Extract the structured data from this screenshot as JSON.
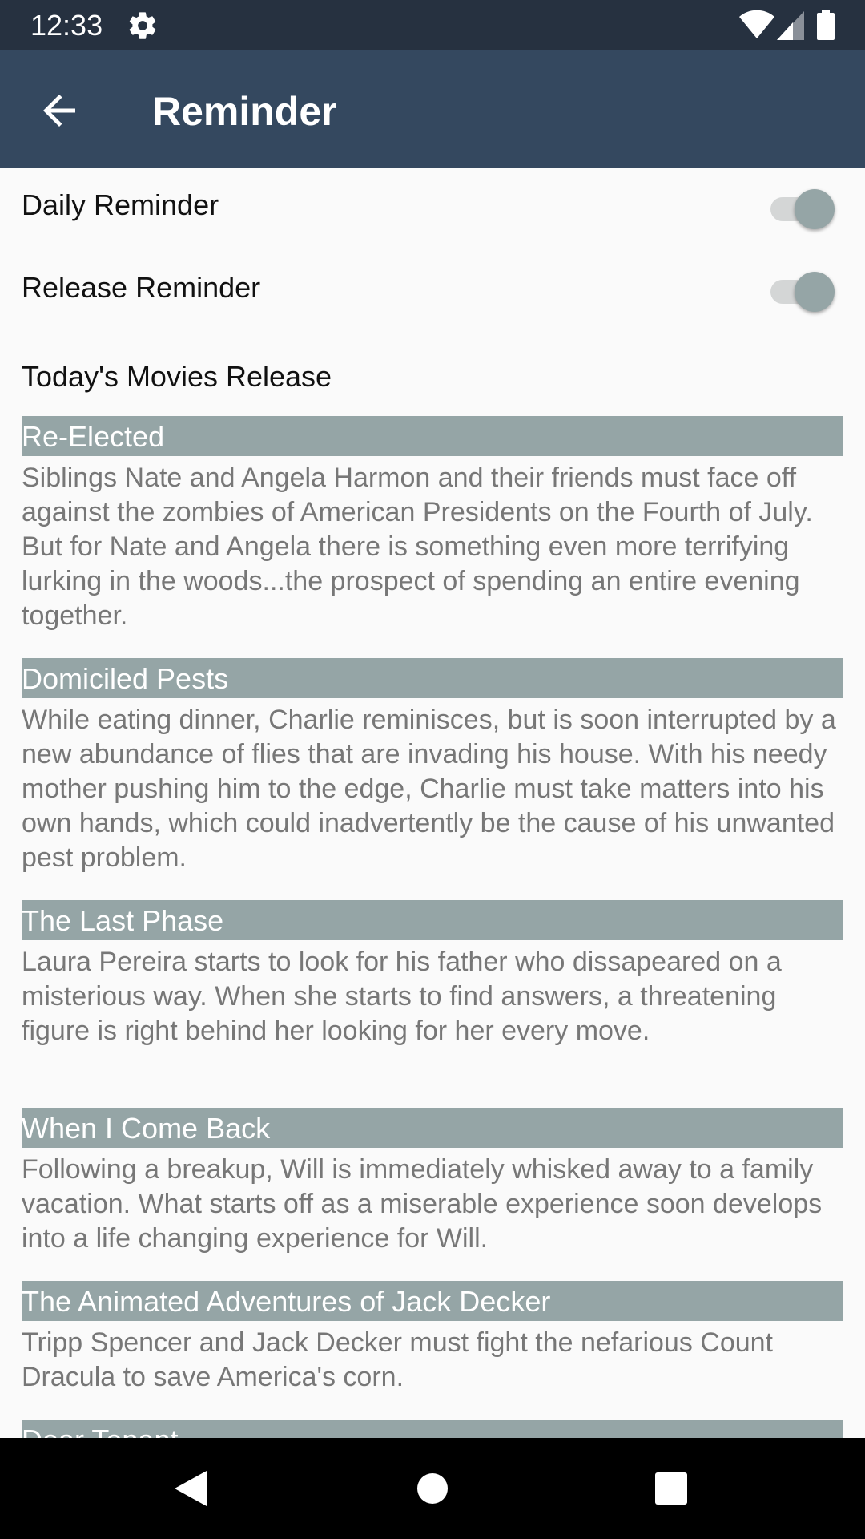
{
  "status_bar": {
    "time": "12:33",
    "icons": [
      "settings-icon",
      "wifi-icon",
      "signal-icon",
      "battery-icon"
    ]
  },
  "app_bar": {
    "title": "Reminder",
    "back_icon": "arrow-back-icon"
  },
  "settings": {
    "daily_reminder": {
      "label": "Daily Reminder",
      "enabled": false
    },
    "release_reminder": {
      "label": "Release Reminder",
      "enabled": false
    }
  },
  "section_title": "Today's Movies Release",
  "movies": [
    {
      "title": "Re-Elected",
      "overview": "Siblings Nate and Angela Harmon and their friends must face off against the zombies of American Presidents on the Fourth of July. But for Nate and Angela there is something even more terrifying lurking in the woods...the prospect of spending an entire evening together."
    },
    {
      "title": "Domiciled Pests",
      "overview": "While eating dinner, Charlie reminisces, but is soon interrupted by a new abundance of flies that are invading his house. With his needy mother pushing him to the edge, Charlie must take matters into his own hands, which could inadvertently be the cause of his unwanted pest problem."
    },
    {
      "title": "The Last Phase",
      "overview": "Laura Pereira starts to look for his father who dissapeared on a misterious way. When she starts to find answers, a threatening figure is right behind her looking for her every move."
    },
    {
      "title": "When I Come Back",
      "overview": "Following a breakup, Will is immediately whisked away to a family vacation. What starts off as a miserable experience soon develops into a life changing experience for Will."
    },
    {
      "title": "The Animated Adventures of Jack Decker",
      "overview": "Tripp Spencer and Jack Decker must fight the nefarious Count Dracula to save America's corn."
    },
    {
      "title": "Dear Tenant",
      "overview": ""
    }
  ],
  "colors": {
    "status_bar": "#263140",
    "app_bar": "#34485f",
    "title_band": "#95a5a6",
    "switch_thumb": "#95a5a6",
    "background": "#fafafa"
  },
  "nav_bar": {
    "icons": [
      "back-triangle-icon",
      "home-circle-icon",
      "recents-square-icon"
    ]
  }
}
